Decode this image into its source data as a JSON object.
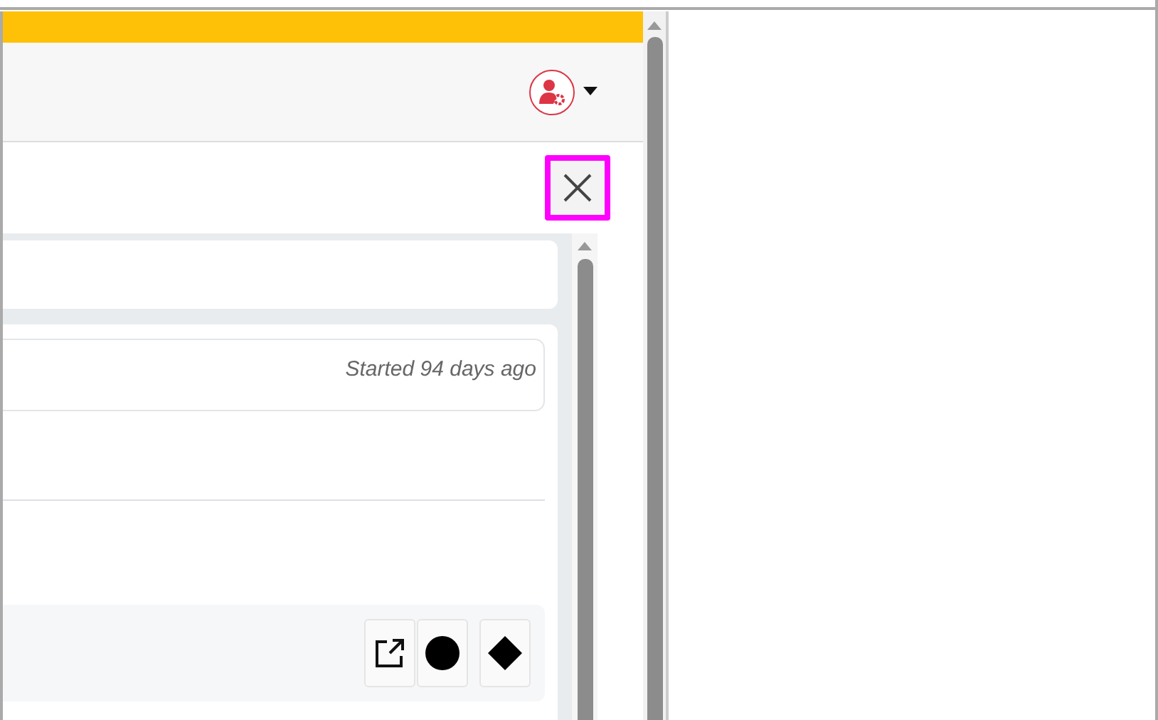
{
  "close_button": {
    "highlighted": true
  },
  "task": {
    "started": "Started 94 days ago"
  }
}
